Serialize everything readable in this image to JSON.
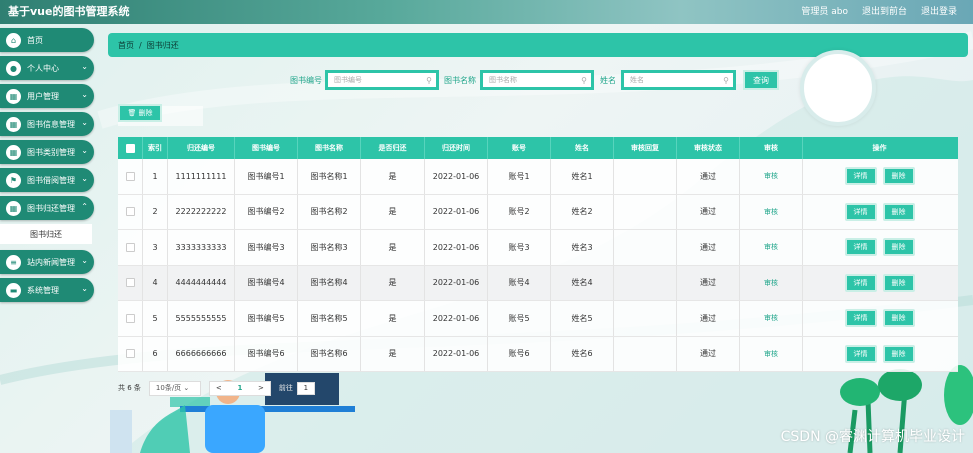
{
  "app_title": "基于vue的图书管理系统",
  "top_right": [
    "管理员 abo",
    "退出到前台",
    "退出登录"
  ],
  "sidebar": {
    "items": [
      {
        "label": "首页",
        "icon": "home-icon",
        "expandable": false
      },
      {
        "label": "个人中心",
        "icon": "user-icon",
        "expandable": true
      },
      {
        "label": "用户管理",
        "icon": "users-icon",
        "expandable": true
      },
      {
        "label": "图书信息管理",
        "icon": "book-icon",
        "expandable": true
      },
      {
        "label": "图书类别管理",
        "icon": "category-icon",
        "expandable": true
      },
      {
        "label": "图书借阅管理",
        "icon": "borrow-icon",
        "expandable": true
      },
      {
        "label": "图书归还管理",
        "icon": "return-icon",
        "expandable": true
      },
      {
        "label": "站内新闻管理",
        "icon": "news-icon",
        "expandable": true
      },
      {
        "label": "系统管理",
        "icon": "system-icon",
        "expandable": true
      }
    ],
    "sub_item": "图书归还"
  },
  "breadcrumb": {
    "home": "首页",
    "separator": "/",
    "current": "图书归还"
  },
  "search": {
    "book_no_label": "图书编号",
    "book_no_placeholder": "图书编号",
    "book_name_label": "图书名称",
    "book_name_placeholder": "图书名称",
    "name_label": "姓名",
    "name_placeholder": "姓名",
    "query_button": "查询"
  },
  "delete_button": "删除",
  "table": {
    "headers": [
      "索引",
      "归还编号",
      "图书编号",
      "图书名称",
      "是否归还",
      "归还时间",
      "账号",
      "姓名",
      "审核回复",
      "审核状态",
      "审核",
      "操作"
    ],
    "rows": [
      {
        "index": "1",
        "return_no": "1111111111",
        "book_no": "图书编号1",
        "book_name": "图书名称1",
        "returned": "是",
        "return_time": "2022-01-06",
        "account": "账号1",
        "name": "姓名1",
        "reply": "",
        "status": "通过",
        "audit": "审核"
      },
      {
        "index": "2",
        "return_no": "2222222222",
        "book_no": "图书编号2",
        "book_name": "图书名称2",
        "returned": "是",
        "return_time": "2022-01-06",
        "account": "账号2",
        "name": "姓名2",
        "reply": "",
        "status": "通过",
        "audit": "审核"
      },
      {
        "index": "3",
        "return_no": "3333333333",
        "book_no": "图书编号3",
        "book_name": "图书名称3",
        "returned": "是",
        "return_time": "2022-01-06",
        "account": "账号3",
        "name": "姓名3",
        "reply": "",
        "status": "通过",
        "audit": "审核"
      },
      {
        "index": "4",
        "return_no": "4444444444",
        "book_no": "图书编号4",
        "book_name": "图书名称4",
        "returned": "是",
        "return_time": "2022-01-06",
        "account": "账号4",
        "name": "姓名4",
        "reply": "",
        "status": "通过",
        "audit": "审核"
      },
      {
        "index": "5",
        "return_no": "5555555555",
        "book_no": "图书编号5",
        "book_name": "图书名称5",
        "returned": "是",
        "return_time": "2022-01-06",
        "account": "账号5",
        "name": "姓名5",
        "reply": "",
        "status": "通过",
        "audit": "审核"
      },
      {
        "index": "6",
        "return_no": "6666666666",
        "book_no": "图书编号6",
        "book_name": "图书名称6",
        "returned": "是",
        "return_time": "2022-01-06",
        "account": "账号6",
        "name": "姓名6",
        "reply": "",
        "status": "通过",
        "audit": "审核"
      }
    ],
    "detail_button": "详情",
    "delete_button": "删除"
  },
  "pager": {
    "total": "共 6 条",
    "page_size": "10条/页",
    "prev": "<",
    "current_page": "1",
    "next": ">",
    "goto_label": "前往",
    "goto_value": "1"
  },
  "watermark": "CSDN @睿渊计算机毕业设计",
  "colors": {
    "accent": "#2dc4a8",
    "sidebar": "#1f8a75",
    "topbar": "#2f7f72"
  }
}
